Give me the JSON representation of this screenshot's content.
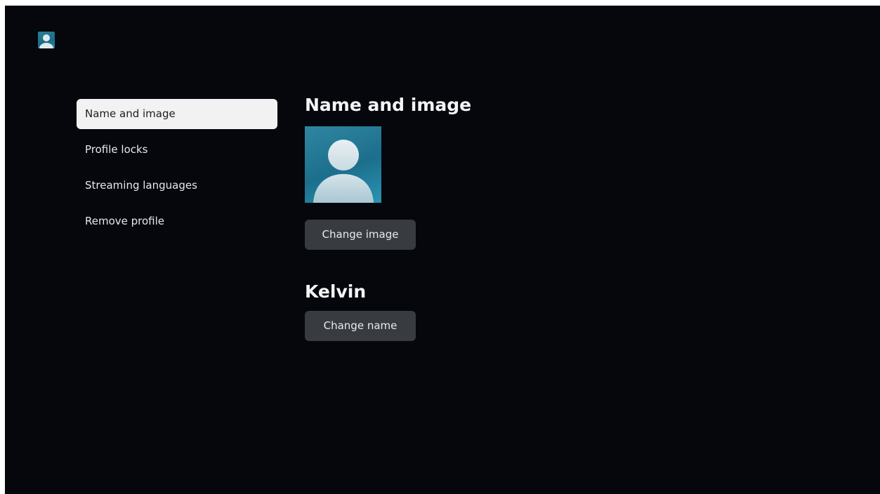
{
  "header": {
    "avatar_icon": "profile-avatar-icon"
  },
  "sidebar": {
    "items": [
      {
        "label": "Name and image",
        "selected": true
      },
      {
        "label": "Profile locks",
        "selected": false
      },
      {
        "label": "Streaming languages",
        "selected": false
      },
      {
        "label": "Remove profile",
        "selected": false
      }
    ]
  },
  "main": {
    "section_title": "Name and image",
    "profile_image_icon": "person-silhouette-icon",
    "change_image_label": "Change image",
    "profile_name": "Kelvin",
    "change_name_label": "Change name"
  },
  "colors": {
    "background": "#05070c",
    "selected_item_bg": "#f2f2f2",
    "button_bg": "#383b40",
    "avatar_blue": "#1c6f8c"
  }
}
